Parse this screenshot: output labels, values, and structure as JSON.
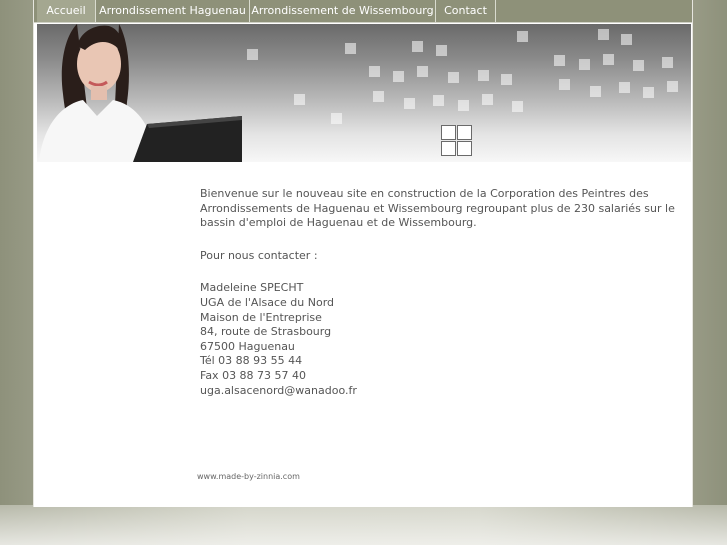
{
  "nav": {
    "items": [
      {
        "label": "Accueil",
        "active": true
      },
      {
        "label": "Arrondissement Haguenau",
        "active": false
      },
      {
        "label": "Arrondissement de Wissembourg",
        "active": false
      },
      {
        "label": "Contact",
        "active": false
      }
    ]
  },
  "banner": {
    "logo_icon": "four-squares-logo",
    "accent_color": "#8e9179"
  },
  "content": {
    "intro": "Bienvenue sur le nouveau site en construction de la Corporation des Peintres des Arrondissements de Haguenau et Wissembourg regroupant plus de 230 salariés sur le bassin d'emploi de Haguenau et de Wissembourg.",
    "contact_heading": "Pour nous contacter :",
    "contact": {
      "name": "Madeleine SPECHT",
      "org": "UGA de l'Alsace du Nord",
      "building": "Maison de l'Entreprise",
      "street": "84, route de Strasbourg",
      "city": "67500 Haguenau",
      "phone": "Tél 03 88 93 55 44",
      "fax": "Fax 03 88 73 57 40",
      "email": "uga.alsacenord@wanadoo.fr"
    }
  },
  "footer": {
    "credit": "www.made-by-zinnia.com"
  }
}
